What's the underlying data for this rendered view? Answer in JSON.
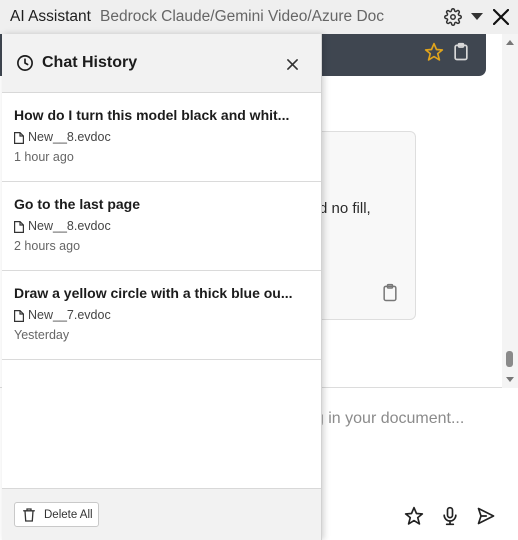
{
  "titlebar": {
    "app_name": "AI Assistant",
    "model_label": "Bedrock Claude/Gemini Video/Azure Doc",
    "icons": {
      "settings": "gear-icon",
      "dropdown": "caret-down-icon",
      "close": "close-icon"
    }
  },
  "background_chat": {
    "card_text": "d no fill,",
    "input_placeholder": "ng in your document...",
    "header_icons": [
      "star-icon",
      "clipboard-icon"
    ],
    "bottom_icons": [
      "star-icon",
      "microphone-icon",
      "send-icon"
    ]
  },
  "history_panel": {
    "title": "Chat History",
    "title_icon": "clock-icon",
    "items": [
      {
        "title": "How do I turn this model black and whit...",
        "file": "New__8.evdoc",
        "time": "1 hour ago"
      },
      {
        "title": "Go to the last page",
        "file": "New__8.evdoc",
        "time": "2 hours ago"
      },
      {
        "title": "Draw a yellow circle with a thick blue ou...",
        "file": "New__7.evdoc",
        "time": "Yesterday"
      }
    ],
    "delete_all_label": "Delete All"
  },
  "colors": {
    "header_dark": "#3f4650",
    "star_accent": "#e0a41c",
    "panel_bg": "#f2f2f2"
  }
}
